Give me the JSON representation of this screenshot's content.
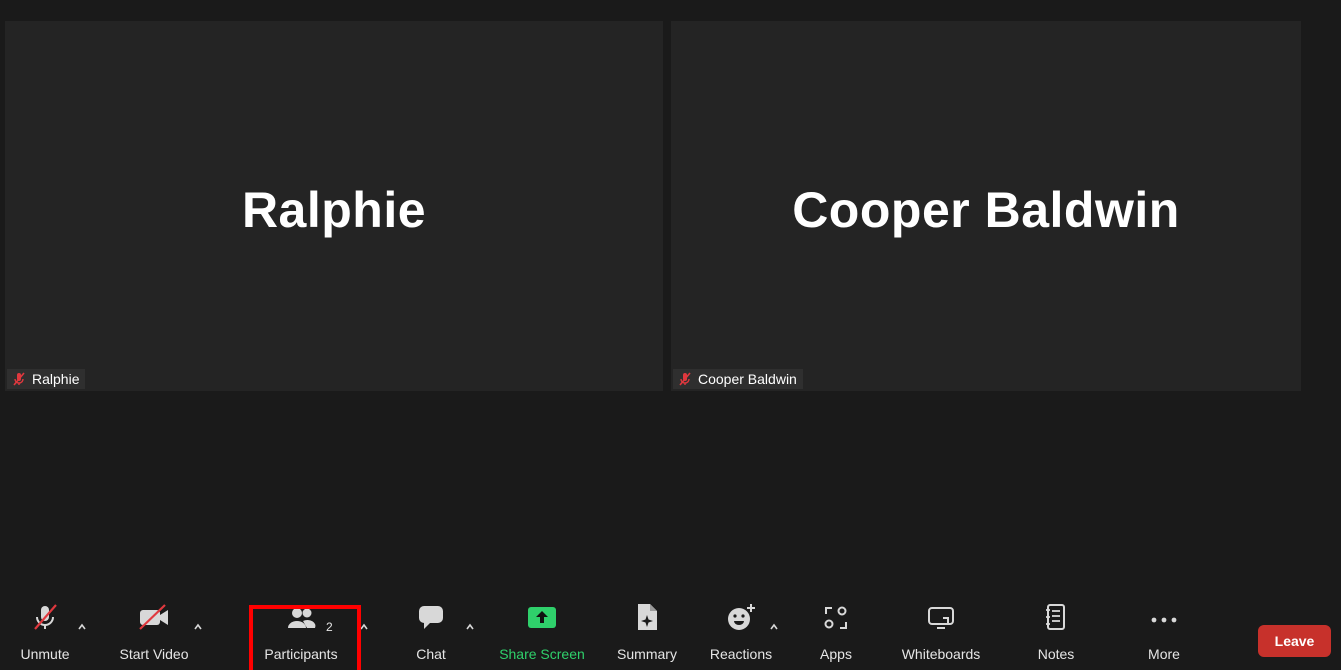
{
  "tiles": [
    {
      "display_name": "Ralphie",
      "label": "Ralphie",
      "muted": true
    },
    {
      "display_name": "Cooper Baldwin",
      "label": "Cooper Baldwin",
      "muted": true
    }
  ],
  "toolbar": {
    "unmute_label": "Unmute",
    "start_video_label": "Start Video",
    "participants_label": "Participants",
    "participants_count": "2",
    "chat_label": "Chat",
    "share_screen_label": "Share Screen",
    "summary_label": "Summary",
    "reactions_label": "Reactions",
    "apps_label": "Apps",
    "whiteboards_label": "Whiteboards",
    "notes_label": "Notes",
    "more_label": "More",
    "leave_label": "Leave"
  },
  "colors": {
    "background": "#1a1a1a",
    "tile_background": "#242424",
    "muted_red": "#e0383e",
    "share_green": "#2fd06b",
    "leave_red": "#c7312b",
    "highlight_red": "#ff0000"
  },
  "icons": {
    "unmute": "mic-muted-icon",
    "start_video": "video-off-icon",
    "participants": "participants-icon",
    "chat": "chat-bubble-icon",
    "share_screen": "share-screen-icon",
    "summary": "summary-icon",
    "reactions": "reactions-icon",
    "apps": "apps-icon",
    "whiteboards": "whiteboard-icon",
    "notes": "notes-icon",
    "more": "more-dots-icon"
  }
}
